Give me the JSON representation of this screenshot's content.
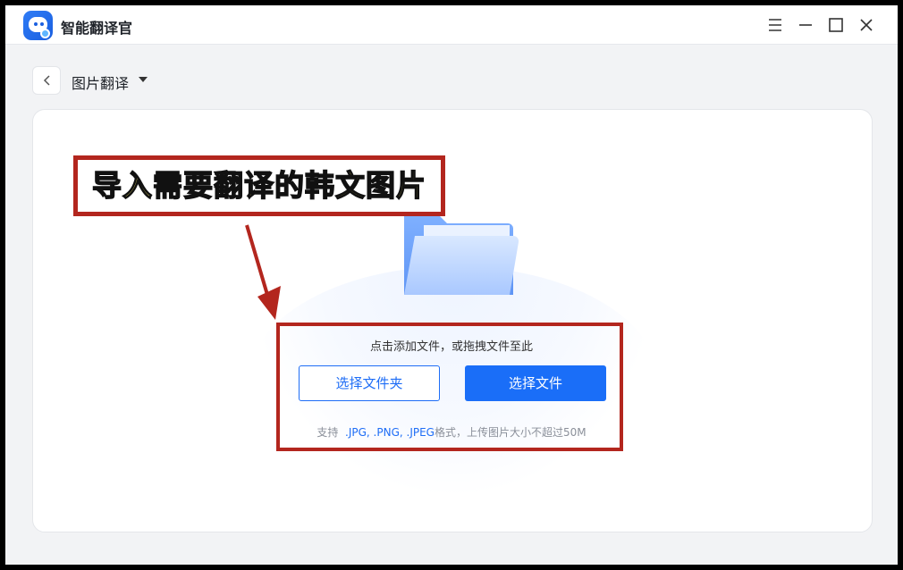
{
  "app": {
    "title": "智能翻译官"
  },
  "toolbar": {
    "page_title": "图片翻译"
  },
  "annotation": {
    "callout": "导入需要翻译的韩文图片"
  },
  "upload": {
    "hint": "点击添加文件，或拖拽文件至此",
    "select_folder_label": "选择文件夹",
    "select_file_label": "选择文件",
    "support_prefix": "支持",
    "support_formats": ".JPG, .PNG, .JPEG",
    "support_suffix": "格式，上传图片大小不超过50M"
  },
  "colors": {
    "accent": "#1a6ef8",
    "annotation": "#b3261e",
    "callout_text": "#fff36b"
  },
  "icons": [
    "app-logo-icon",
    "menu-icon",
    "minimize-icon",
    "maximize-icon",
    "close-icon",
    "back-chevron-icon",
    "caret-down-icon",
    "folder-icon",
    "arrow-icon"
  ]
}
